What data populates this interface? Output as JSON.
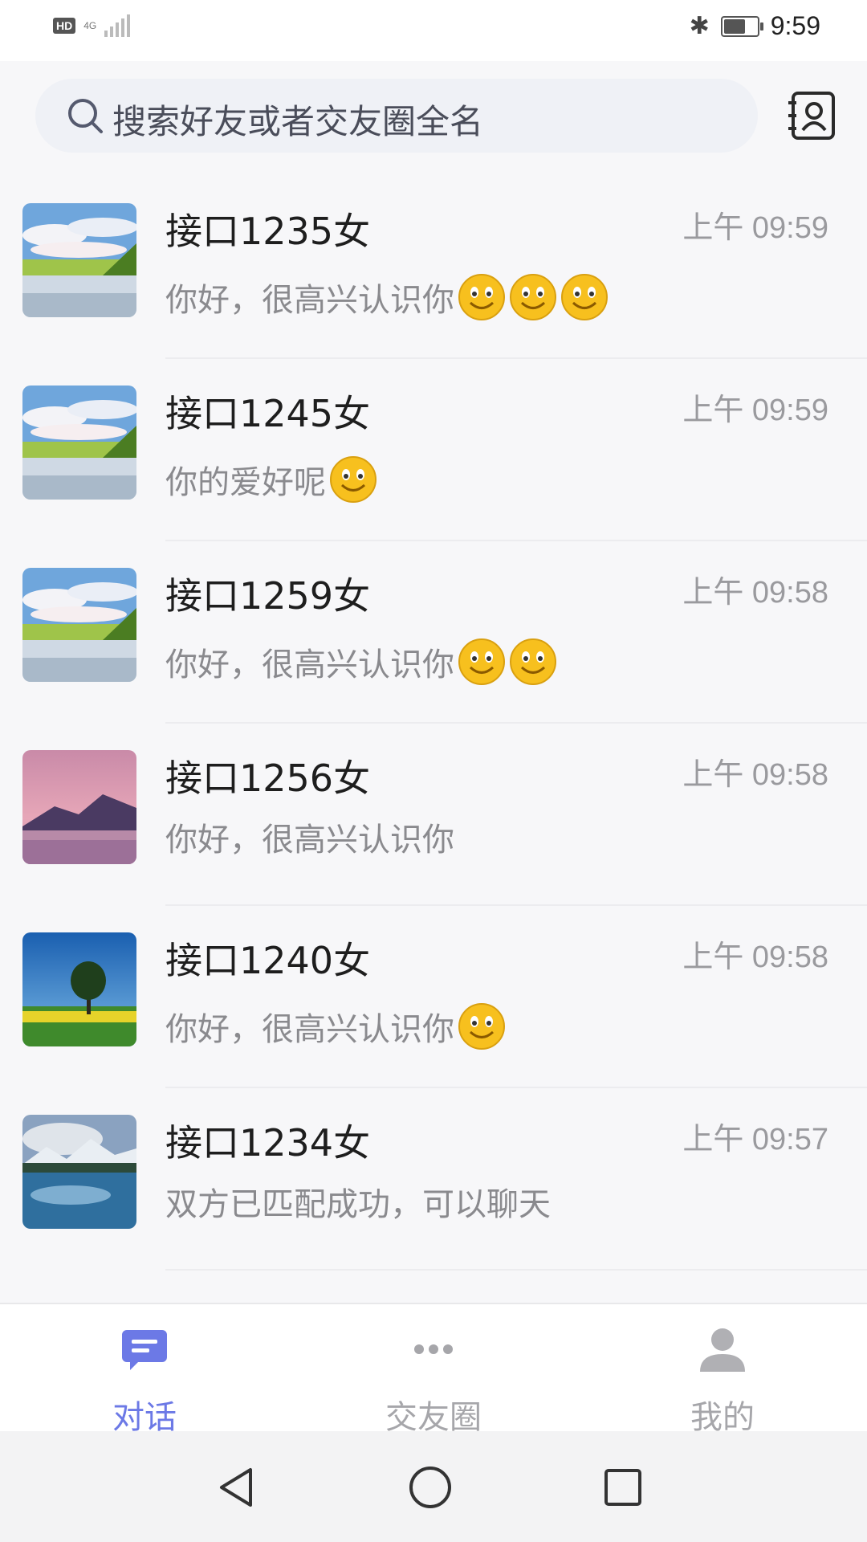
{
  "status_bar": {
    "hd": "HD",
    "network": "4G",
    "time": "9:59"
  },
  "search": {
    "placeholder": "搜索好友或者交友圈全名"
  },
  "conversations": [
    {
      "name": "接口1235女",
      "time": "上午 09:59",
      "message": "你好，很高兴认识你",
      "emoji_count": 3,
      "avatar": "lake-clouds"
    },
    {
      "name": "接口1245女",
      "time": "上午 09:59",
      "message": "你的爱好呢",
      "emoji_count": 1,
      "avatar": "lake-clouds"
    },
    {
      "name": "接口1259女",
      "time": "上午 09:58",
      "message": "你好，很高兴认识你",
      "emoji_count": 2,
      "avatar": "lake-clouds"
    },
    {
      "name": "接口1256女",
      "time": "上午 09:58",
      "message": "你好，很高兴认识你",
      "emoji_count": 0,
      "avatar": "pink-mountains"
    },
    {
      "name": "接口1240女",
      "time": "上午 09:58",
      "message": "你好，很高兴认识你",
      "emoji_count": 1,
      "avatar": "tree-field"
    },
    {
      "name": "接口1234女",
      "time": "上午 09:57",
      "message": "双方已匹配成功，可以聊天",
      "emoji_count": 0,
      "avatar": "mountain-lake"
    }
  ],
  "tabs": [
    {
      "label": "对话",
      "icon": "chat-bubble-icon",
      "active": true
    },
    {
      "label": "交友圈",
      "icon": "more-dots-icon",
      "active": false
    },
    {
      "label": "我的",
      "icon": "person-icon",
      "active": false
    }
  ],
  "colors": {
    "accent": "#6c79e6",
    "inactive": "#a6a6aa",
    "emoji": "#f7c01e"
  }
}
